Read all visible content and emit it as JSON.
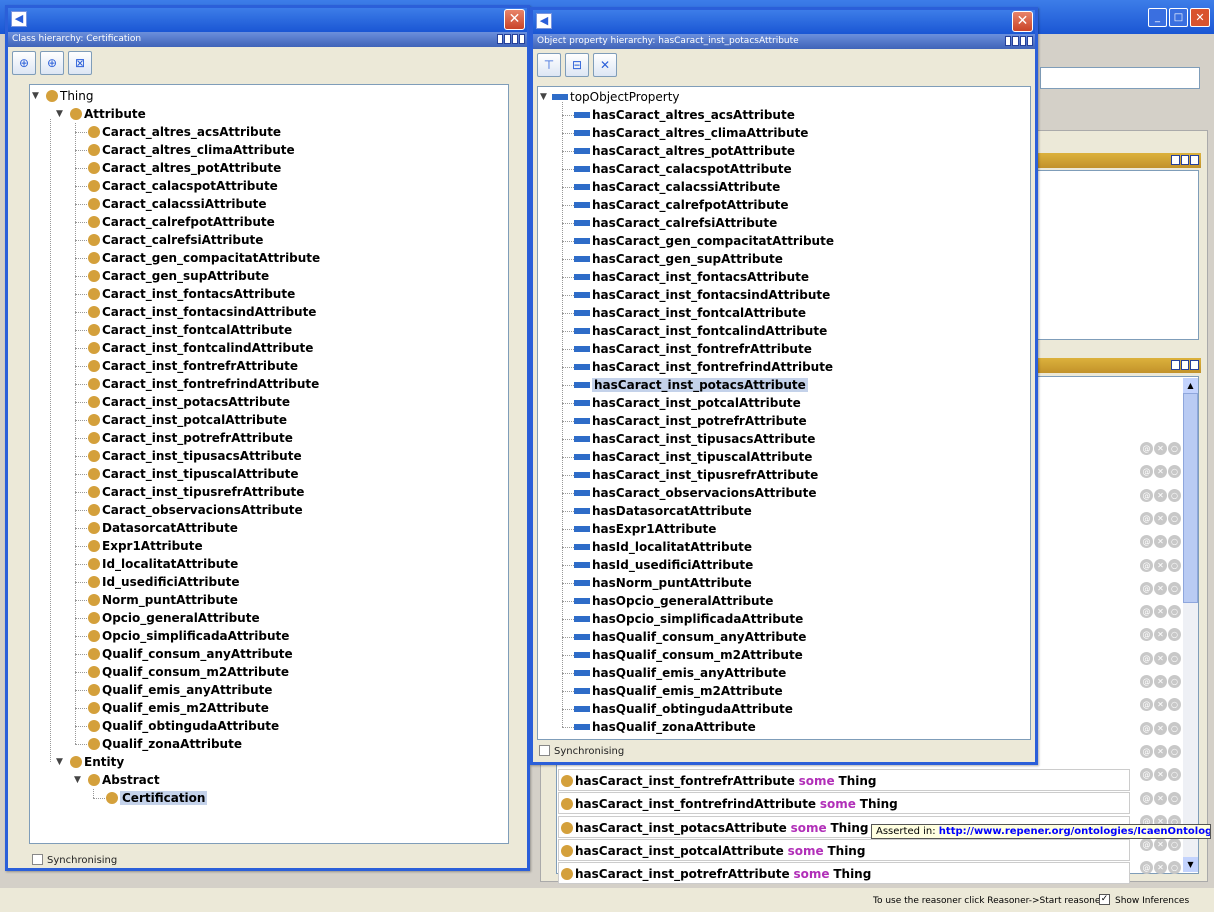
{
  "status": {
    "reasoner_hint": "To use the reasoner click Reasoner->Start reasoner",
    "show_inferences": "Show Inferences"
  },
  "class_window": {
    "panel_title": "Class hierarchy: Certification",
    "sync": "Synchronising",
    "root": "Thing",
    "attribute": "Attribute",
    "attribute_children": [
      "Caract_altres_acsAttribute",
      "Caract_altres_climaAttribute",
      "Caract_altres_potAttribute",
      "Caract_calacspotAttribute",
      "Caract_calacssiAttribute",
      "Caract_calrefpotAttribute",
      "Caract_calrefsiAttribute",
      "Caract_gen_compacitatAttribute",
      "Caract_gen_supAttribute",
      "Caract_inst_fontacsAttribute",
      "Caract_inst_fontacsindAttribute",
      "Caract_inst_fontcalAttribute",
      "Caract_inst_fontcalindAttribute",
      "Caract_inst_fontrefrAttribute",
      "Caract_inst_fontrefrindAttribute",
      "Caract_inst_potacsAttribute",
      "Caract_inst_potcalAttribute",
      "Caract_inst_potrefrAttribute",
      "Caract_inst_tipusacsAttribute",
      "Caract_inst_tipuscalAttribute",
      "Caract_inst_tipusrefrAttribute",
      "Caract_observacionsAttribute",
      "DatasorcatAttribute",
      "Expr1Attribute",
      "Id_localitatAttribute",
      "Id_usedificiAttribute",
      "Norm_puntAttribute",
      "Opcio_generalAttribute",
      "Opcio_simplificadaAttribute",
      "Qualif_consum_anyAttribute",
      "Qualif_consum_m2Attribute",
      "Qualif_emis_anyAttribute",
      "Qualif_emis_m2Attribute",
      "Qualif_obtingudaAttribute",
      "Qualif_zonaAttribute"
    ],
    "entity": "Entity",
    "abstract": "Abstract",
    "certification": "Certification"
  },
  "prop_window": {
    "panel_title": "Object property hierarchy: hasCaract_inst_potacsAttribute",
    "sync": "Synchronising",
    "root": "topObjectProperty",
    "children": [
      "hasCaract_altres_acsAttribute",
      "hasCaract_altres_climaAttribute",
      "hasCaract_altres_potAttribute",
      "hasCaract_calacspotAttribute",
      "hasCaract_calacssiAttribute",
      "hasCaract_calrefpotAttribute",
      "hasCaract_calrefsiAttribute",
      "hasCaract_gen_compacitatAttribute",
      "hasCaract_gen_supAttribute",
      "hasCaract_inst_fontacsAttribute",
      "hasCaract_inst_fontacsindAttribute",
      "hasCaract_inst_fontcalAttribute",
      "hasCaract_inst_fontcalindAttribute",
      "hasCaract_inst_fontrefrAttribute",
      "hasCaract_inst_fontrefrindAttribute",
      "hasCaract_inst_potacsAttribute",
      "hasCaract_inst_potcalAttribute",
      "hasCaract_inst_potrefrAttribute",
      "hasCaract_inst_tipusacsAttribute",
      "hasCaract_inst_tipuscalAttribute",
      "hasCaract_inst_tipusrefrAttribute",
      "hasCaract_observacionsAttribute",
      "hasDatasorcatAttribute",
      "hasExpr1Attribute",
      "hasId_localitatAttribute",
      "hasId_usedificiAttribute",
      "hasNorm_puntAttribute",
      "hasOpcio_generalAttribute",
      "hasOpcio_simplificadaAttribute",
      "hasQualif_consum_anyAttribute",
      "hasQualif_consum_m2Attribute",
      "hasQualif_emis_anyAttribute",
      "hasQualif_emis_m2Attribute",
      "hasQualif_obtingudaAttribute",
      "hasQualif_zonaAttribute"
    ],
    "selected_index": 15
  },
  "axioms": {
    "keyword": "some",
    "filler": "Thing",
    "rows": [
      "hasCaract_inst_fontrefrAttribute",
      "hasCaract_inst_fontrefrindAttribute",
      "hasCaract_inst_potacsAttribute",
      "hasCaract_inst_potcalAttribute",
      "hasCaract_inst_potrefrAttribute"
    ]
  },
  "tooltip": {
    "prefix": "Asserted in:",
    "url": "http://www.repener.org/ontologies/IcaenOntology.ow"
  }
}
